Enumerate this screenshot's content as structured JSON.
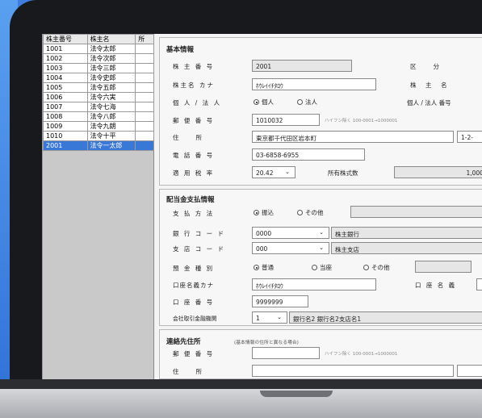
{
  "list": {
    "headers": [
      "株主番号",
      "株主名",
      "所"
    ],
    "rows": [
      {
        "no": "1001",
        "name": "法令太郎"
      },
      {
        "no": "1002",
        "name": "法令次郎"
      },
      {
        "no": "1003",
        "name": "法令三郎"
      },
      {
        "no": "1004",
        "name": "法令史郎"
      },
      {
        "no": "1005",
        "name": "法令五郎"
      },
      {
        "no": "1006",
        "name": "法令六実"
      },
      {
        "no": "1007",
        "name": "法令七海"
      },
      {
        "no": "1008",
        "name": "法令八郎"
      },
      {
        "no": "1009",
        "name": "法令九朗"
      },
      {
        "no": "1010",
        "name": "法令十平"
      },
      {
        "no": "2001",
        "name": "法令一太郎"
      }
    ],
    "selected_index": 10
  },
  "basic": {
    "title": "基本情報",
    "holder_no_label": "株 主 番 号",
    "holder_no_value": "2001",
    "kubun_label": "区　　分",
    "name_kana_label": "株主名 カナ",
    "name_kana_value": "ﾎｳﾚｲｲﾁﾀﾛｳ",
    "holder_name_label": "株　主　名",
    "person_corp_label": "個 人 / 法 人",
    "radio_person": "個人",
    "radio_corp": "法人",
    "person_corp_no_label": "個人 / 法人 番号",
    "postal_label": "郵 便 番 号",
    "postal_value": "1010032",
    "postal_hint": "ハイフン除く 100-0001→1000001",
    "address_label": "住　　所",
    "address_value": "東京都千代田区岩本町",
    "address2_value": "1-2-",
    "phone_label": "電 話 番 号",
    "phone_value": "03-6858-6955",
    "tax_label": "適 用 税 率",
    "tax_value": "20.42",
    "shares_label": "所有株式数",
    "shares_value": "1,000"
  },
  "dividend": {
    "title": "配当金支払情報",
    "method_label": "支 払 方 法",
    "radio_transfer": "振込",
    "radio_other": "その他",
    "bank_label": "銀 行 コ ー ド",
    "bank_code": "0000",
    "bank_name": "株主銀行",
    "branch_label": "支 店 コ ー ド",
    "branch_code": "000",
    "branch_name": "株主支店",
    "deposit_label": "預 金 種 別",
    "radio_ordinary": "普通",
    "radio_checking": "当座",
    "radio_dep_other": "その他",
    "account_kana_label": "口座名義カナ",
    "account_kana_value": "ﾎｳﾚｲｲﾁﾀﾛｳ",
    "account_name_label": "口 座 名 義",
    "account_no_label": "口 座 番 号",
    "account_no_value": "9999999",
    "institution_label": "会社取引金融機関",
    "institution_value": "1",
    "institution_text": "銀行名2 銀行名2支店名1"
  },
  "contact": {
    "title": "連絡先住所",
    "subtitle": "(基本情報の住所と異なる場合)",
    "postal_label": "郵 便 番 号",
    "postal_hint": "ハイフン除く 100-0001→1000001",
    "address_label": "住　　所"
  }
}
